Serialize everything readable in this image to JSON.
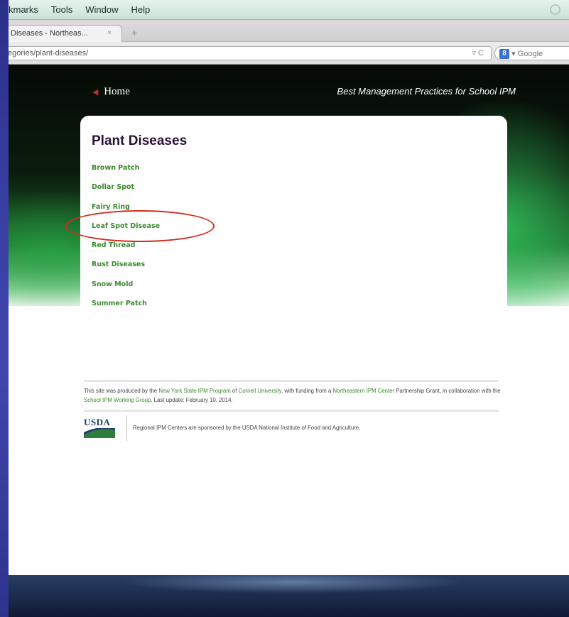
{
  "menubar": {
    "items": [
      "kmarks",
      "Tools",
      "Window",
      "Help"
    ]
  },
  "tab": {
    "title": "Diseases - Northeas...",
    "close": "×",
    "new_tab": "+"
  },
  "url": {
    "value": "egories/plant-diseases/",
    "reload": "C",
    "search_placeholder": "Google",
    "search_engine_badge": "8"
  },
  "page": {
    "home_label": "Home",
    "site_title": "Best Management Practices for School IPM",
    "heading": "Plant Diseases",
    "diseases": [
      "Brown Patch",
      "Dollar Spot",
      "Fairy Ring",
      "Leaf Spot Disease",
      "Red Thread",
      "Rust Diseases",
      "Snow Mold",
      "Summer Patch"
    ],
    "footer": {
      "t1": "This site was produced by the ",
      "link1": "New York State IPM Program",
      "t2": " of ",
      "link2": "Cornell University",
      "t3": ", with funding from a ",
      "link3": "Northeastern IPM Center",
      "t4": " Partnership Grant, in collaboration with the ",
      "link4": "School IPM Working Group",
      "t5": ". Last update: February 10, 2014.",
      "usda_logo": "USDA",
      "usda_line": "Regional IPM Centers are sponsored by the USDA National Institute of Food and Agriculture."
    }
  },
  "colors": {
    "link_green": "#3b8a2e",
    "heading": "#2a1036",
    "highlight": "#d22a1c"
  }
}
